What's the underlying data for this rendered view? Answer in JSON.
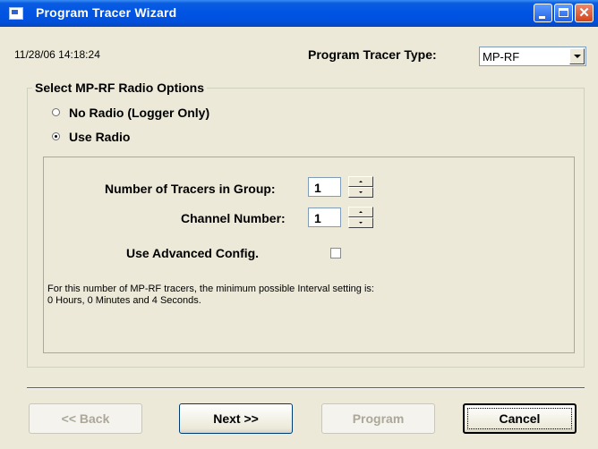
{
  "window": {
    "title": "Program Tracer Wizard"
  },
  "header": {
    "timestamp": "11/28/06 14:18:24",
    "type_label": "Program Tracer Type:",
    "type_value": "MP-RF"
  },
  "radio_group": {
    "title": "Select MP-RF Radio Options",
    "options": [
      {
        "label": "No Radio (Logger Only)",
        "selected": false
      },
      {
        "label": "Use Radio",
        "selected": true
      }
    ]
  },
  "radio_settings": {
    "num_tracers_label": "Number of Tracers in Group:",
    "num_tracers_value": "1",
    "channel_label": "Channel Number:",
    "channel_value": "1",
    "advanced_label": "Use Advanced Config.",
    "advanced_checked": false,
    "info_line1": "For this number of MP-RF tracers, the minimum possible Interval setting is:",
    "info_line2": "0 Hours, 0 Minutes and  4 Seconds."
  },
  "buttons": {
    "back": "<< Back",
    "next": "Next >>",
    "program": "Program",
    "cancel": "Cancel"
  },
  "colors": {
    "titlebar": "#0054e3",
    "dialog_bg": "#ece9d8",
    "disabled_text": "#aca899"
  }
}
